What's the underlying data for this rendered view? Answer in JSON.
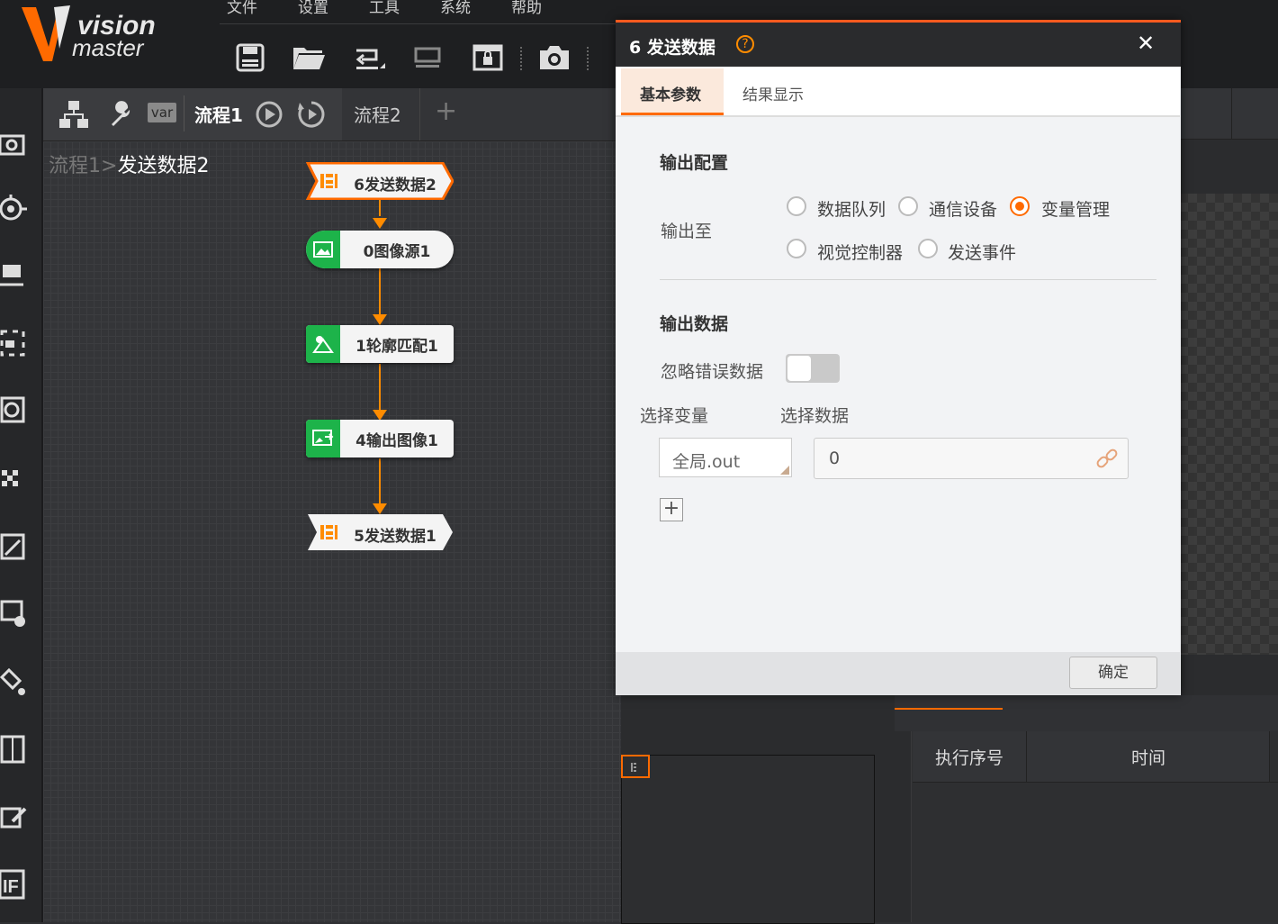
{
  "menu": [
    "文件",
    "设置",
    "工具",
    "系统",
    "帮助"
  ],
  "logo": {
    "line1": "vision",
    "line2": "master"
  },
  "tabs": {
    "flow1": "流程1",
    "flow2": "流程2",
    "var_icon": "var",
    "add": "+"
  },
  "breadcrumb": {
    "parent": "流程1",
    "sep": ">",
    "current": "发送数据2"
  },
  "nodes": [
    {
      "label": "6发送数据2",
      "type": "send",
      "selected": true
    },
    {
      "label": "0图像源1",
      "type": "image-source"
    },
    {
      "label": "1轮廓匹配1",
      "type": "contour-match"
    },
    {
      "label": "4输出图像1",
      "type": "output-image"
    },
    {
      "label": "5发送数据1",
      "type": "send"
    }
  ],
  "dialog": {
    "title": "6 发送数据",
    "help": "?",
    "close": "✕",
    "tabs": [
      "基本参数",
      "结果显示"
    ],
    "section_output_config": "输出配置",
    "output_to_label": "输出至",
    "radio_options": [
      {
        "label": "数据队列",
        "checked": false
      },
      {
        "label": "通信设备",
        "checked": false
      },
      {
        "label": "变量管理",
        "checked": true
      },
      {
        "label": "视觉控制器",
        "checked": false
      },
      {
        "label": "发送事件",
        "checked": false
      }
    ],
    "section_output_data": "输出数据",
    "ignore_error_label": "忽略错误数据",
    "ignore_error_on": false,
    "select_var_label": "选择变量",
    "select_data_label": "选择数据",
    "select_var_value": "全局.out",
    "select_data_value": "0",
    "add": "+",
    "confirm": "确定"
  },
  "table": {
    "headers": [
      "执行序号",
      "时间"
    ]
  },
  "colors": {
    "accent": "#ff6a00",
    "node_green": "#1db34a",
    "title_bar": "#2a2b2d"
  }
}
